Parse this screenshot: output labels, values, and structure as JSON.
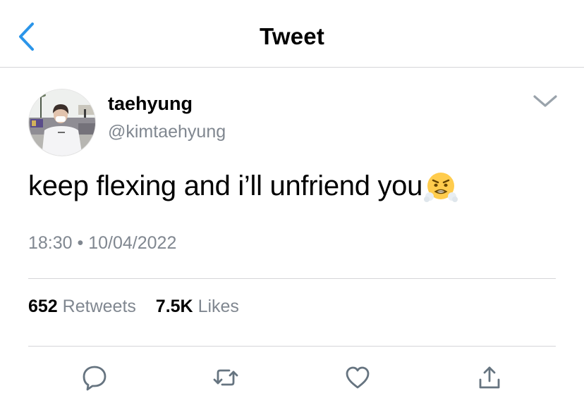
{
  "header": {
    "title": "Tweet",
    "back_icon": "chevron-left-icon"
  },
  "tweet": {
    "author": {
      "name": "taehyung",
      "handle": "@kimtaehyung"
    },
    "text": "keep flexing and i’ll unfriend you",
    "emoji": "face-with-steam-from-nose",
    "time": "18:30",
    "separator": "•",
    "date": "10/04/2022"
  },
  "stats": {
    "retweets_count": "652",
    "retweets_label": "Retweets",
    "likes_count": "7.5K",
    "likes_label": "Likes"
  },
  "actions": [
    {
      "name": "reply",
      "icon": "comment-icon"
    },
    {
      "name": "retweet",
      "icon": "retweet-icon"
    },
    {
      "name": "like",
      "icon": "heart-icon"
    },
    {
      "name": "share",
      "icon": "share-icon"
    }
  ],
  "colors": {
    "accent": "#1da1f2",
    "secondary_text": "#808790",
    "divider": "#d5d5d8",
    "icon_gray": "#667480"
  }
}
